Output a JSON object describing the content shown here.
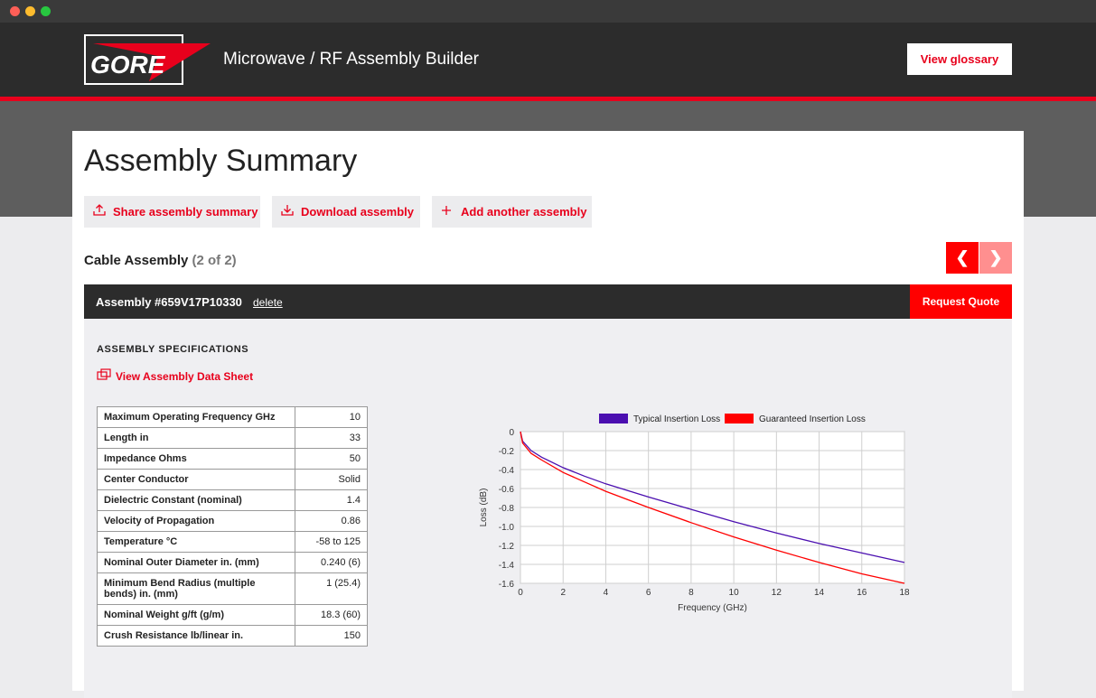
{
  "window": {
    "controls": [
      "close",
      "minimize",
      "maximize"
    ]
  },
  "header": {
    "logo_text": "GORE",
    "app_title": "Microwave / RF Assembly Builder",
    "glossary_label": "View glossary"
  },
  "page": {
    "title": "Assembly Summary",
    "actions": [
      {
        "icon": "upload-icon",
        "label": "Share assembly summary"
      },
      {
        "icon": "download-icon",
        "label": "Download assembly"
      },
      {
        "icon": "plus-icon",
        "label": "Add another assembly"
      }
    ]
  },
  "section": {
    "title": "Cable Assembly",
    "count": "(2 of 2)"
  },
  "assembly": {
    "title": "Assembly #659V17P10330",
    "delete_label": "delete",
    "quote_label": "Request Quote"
  },
  "specs": {
    "heading": "ASSEMBLY SPECIFICATIONS",
    "data_sheet_label": "View Assembly Data Sheet",
    "rows": [
      {
        "label": "Maximum Operating Frequency GHz",
        "value": "10"
      },
      {
        "label": "Length in",
        "value": "33"
      },
      {
        "label": "Impedance Ohms",
        "value": "50"
      },
      {
        "label": "Center Conductor",
        "value": "Solid"
      },
      {
        "label": "Dielectric Constant (nominal)",
        "value": "1.4"
      },
      {
        "label": "Velocity of Propagation",
        "value": "0.86"
      },
      {
        "label": "Temperature °C",
        "value": "-58 to 125"
      },
      {
        "label": "Nominal Outer Diameter in. (mm)",
        "value": "0.240 (6)"
      },
      {
        "label": "Minimum Bend Radius (multiple bends) in. (mm)",
        "value": "1 (25.4)"
      },
      {
        "label": "Nominal Weight g/ft (g/m)",
        "value": "18.3 (60)"
      },
      {
        "label": "Crush Resistance lb/linear in.",
        "value": "150"
      }
    ]
  },
  "colors": {
    "brand_red": "#e8001c",
    "typical": "#4b0fb0",
    "guaranteed": "#ff0000"
  },
  "chart_data": {
    "type": "line",
    "xlabel": "Frequency (GHz)",
    "ylabel": "Loss (dB)",
    "xlim": [
      0,
      18
    ],
    "ylim": [
      -1.6,
      0
    ],
    "xticks": [
      0,
      2,
      4,
      6,
      8,
      10,
      12,
      14,
      16,
      18
    ],
    "yticks": [
      0,
      -0.2,
      -0.4,
      -0.6,
      -0.8,
      -1.0,
      -1.2,
      -1.4,
      -1.6
    ],
    "ytick_labels": [
      "0",
      "-0.2",
      "-0.4",
      "-0.6",
      "-0.8",
      "-1.0",
      "-1.2",
      "-1.4",
      "-1.6"
    ],
    "grid": true,
    "legend": "top",
    "series": [
      {
        "name": "Typical Insertion Loss",
        "color": "#4b0fb0",
        "x": [
          0,
          0.1,
          0.5,
          1,
          2,
          3,
          4,
          6,
          8,
          10,
          12,
          14,
          16,
          18
        ],
        "y": [
          0,
          -0.1,
          -0.2,
          -0.27,
          -0.38,
          -0.47,
          -0.55,
          -0.69,
          -0.82,
          -0.95,
          -1.07,
          -1.18,
          -1.28,
          -1.38
        ]
      },
      {
        "name": "Guaranteed Insertion Loss",
        "color": "#ff0000",
        "x": [
          0,
          0.1,
          0.5,
          1,
          2,
          3,
          4,
          6,
          8,
          10,
          12,
          14,
          16,
          18
        ],
        "y": [
          0,
          -0.12,
          -0.23,
          -0.3,
          -0.43,
          -0.53,
          -0.63,
          -0.8,
          -0.96,
          -1.11,
          -1.25,
          -1.38,
          -1.5,
          -1.6
        ]
      }
    ]
  }
}
